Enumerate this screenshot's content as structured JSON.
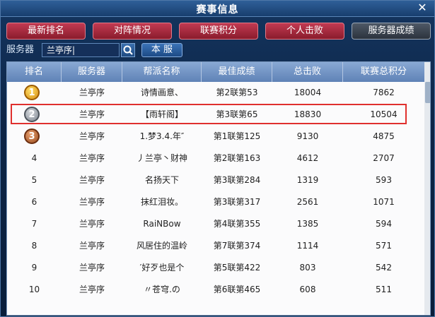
{
  "window": {
    "title": "赛事信息"
  },
  "tabs": [
    {
      "label": "最新排名"
    },
    {
      "label": "对阵情况"
    },
    {
      "label": "联赛积分"
    },
    {
      "label": "个人击败"
    },
    {
      "label": "服务器成绩"
    }
  ],
  "server": {
    "label": "服务器",
    "value": "兰亭序|",
    "button": "本 服"
  },
  "table": {
    "headers": [
      "排名",
      "服务器",
      "帮派名称",
      "最佳成绩",
      "总击败",
      "联赛总积分"
    ],
    "rows": [
      {
        "rank": "1",
        "server": "兰亭序",
        "guild": "诗情画意、",
        "best": "第2联第53",
        "kills": "18004",
        "points": "7862"
      },
      {
        "rank": "2",
        "server": "兰亭序",
        "guild": "【雨轩阁】",
        "best": "第3联第65",
        "kills": "18830",
        "points": "10504"
      },
      {
        "rank": "3",
        "server": "兰亭序",
        "guild": "1.梦3.4.年″",
        "best": "第1联第125",
        "kills": "9130",
        "points": "4875"
      },
      {
        "rank": "4",
        "server": "兰亭序",
        "guild": "丿兰亭丶财神",
        "best": "第2联第163",
        "kills": "4612",
        "points": "2707"
      },
      {
        "rank": "5",
        "server": "兰亭序",
        "guild": "名扬天下",
        "best": "第3联第284",
        "kills": "1319",
        "points": "593"
      },
      {
        "rank": "6",
        "server": "兰亭序",
        "guild": "抹红泪妆。",
        "best": "第3联第317",
        "kills": "2561",
        "points": "1071"
      },
      {
        "rank": "7",
        "server": "兰亭序",
        "guild": "RaiNBow",
        "best": "第4联第355",
        "kills": "1385",
        "points": "594"
      },
      {
        "rank": "8",
        "server": "兰亭序",
        "guild": "风居住的温岭",
        "best": "第7联第374",
        "kills": "1114",
        "points": "571"
      },
      {
        "rank": "9",
        "server": "兰亭序",
        "guild": "′好歹也是个",
        "best": "第5联第422",
        "kills": "803",
        "points": "542"
      },
      {
        "rank": "10",
        "server": "兰亭序",
        "guild": "〃苍穹.の",
        "best": "第6联第465",
        "kills": "608",
        "points": "511"
      }
    ]
  },
  "colors": {
    "highlight": "#e0302e"
  }
}
